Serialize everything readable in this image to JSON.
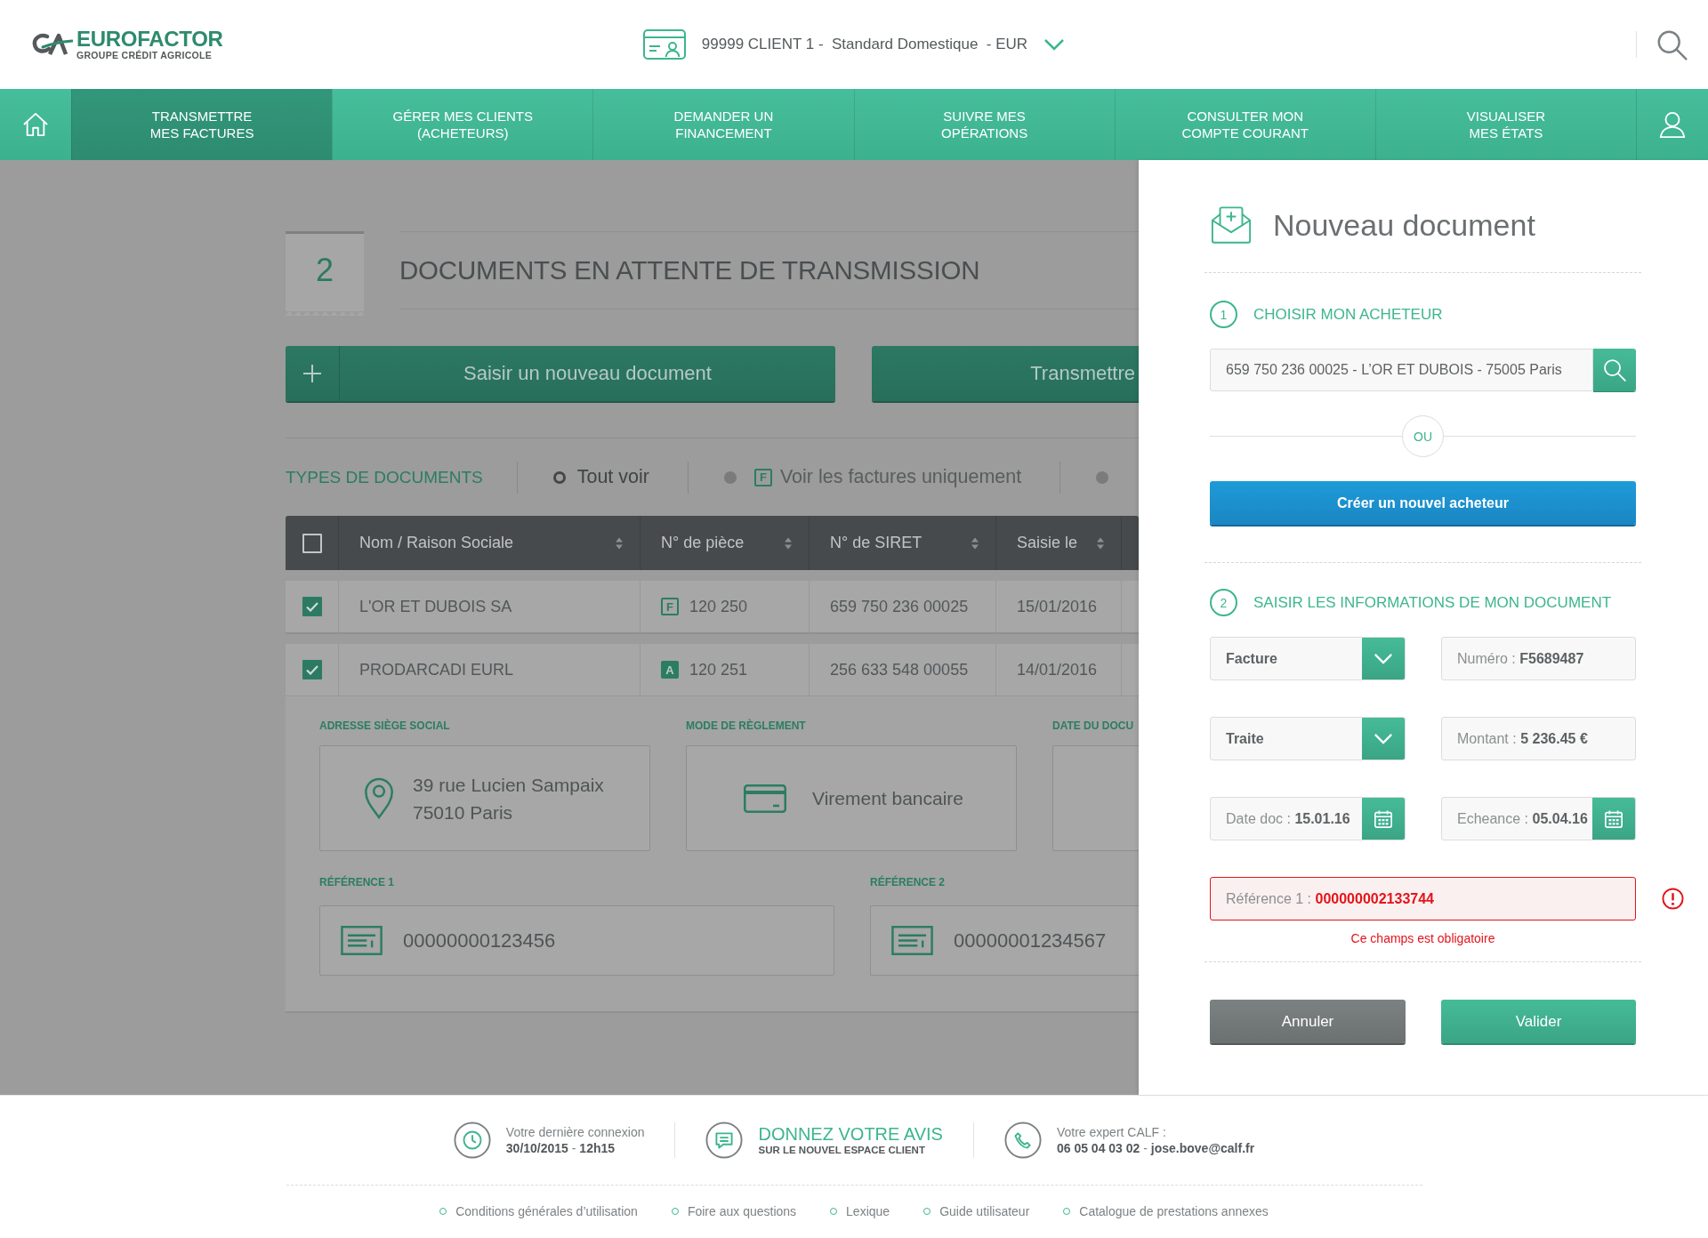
{
  "header": {
    "logo": {
      "brand": "EUROFACTOR",
      "tagline": "GROUPE CRÉDIT AGRICOLE"
    },
    "client_selector": {
      "label": "99999 CLIENT 1 -  Standard Domestique  - EUR"
    }
  },
  "nav": {
    "items": [
      {
        "label": "TRANSMETTRE\nMES FACTURES",
        "selected": true
      },
      {
        "label": "GÉRER MES CLIENTS\n(ACHETEURS)",
        "selected": false
      },
      {
        "label": "DEMANDER UN\nFINANCEMENT",
        "selected": false
      },
      {
        "label": "SUIVRE MES\nOPÉRATIONS",
        "selected": false
      },
      {
        "label": "CONSULTER MON\nCOMPTE COURANT",
        "selected": false
      },
      {
        "label": "VISUALISER\nMES ÉTATS",
        "selected": false
      }
    ]
  },
  "page_header": {
    "count": "2",
    "title": "DOCUMENTS EN ATTENTE DE TRANSMISSION"
  },
  "actions": [
    {
      "kind": "add",
      "label": "Saisir un nouveau document"
    },
    {
      "kind": "plain",
      "label": "Transmettre"
    }
  ],
  "document_types": {
    "label": "TYPES DE DOCUMENTS",
    "options": [
      {
        "label": "Tout voir",
        "selected": true
      },
      {
        "badge": "F",
        "label": "Voir les factures uniquement",
        "selected": false
      },
      {
        "selected": false
      }
    ]
  },
  "table": {
    "all_checked": false,
    "columns": [
      {
        "label": "Nom / Raison Sociale",
        "sortable": true
      },
      {
        "label": "N° de pièce",
        "sortable": true
      },
      {
        "label": "N° de SIRET",
        "sortable": true
      },
      {
        "label": "Saisie le",
        "sortable": true
      }
    ],
    "rows": [
      {
        "checked": true,
        "name": "L'OR ET DUBOIS SA",
        "doc_type": {
          "kind": "invoice",
          "code": "F"
        },
        "piece": "120 250",
        "siret": "659 750 236 00025",
        "date": "15/01/2016",
        "expanded": false
      },
      {
        "checked": true,
        "name": "PRODARCADI EURL",
        "doc_type": {
          "kind": "credit",
          "code": "A"
        },
        "piece": "120 251",
        "siret": "256 633 548 00055",
        "date": "14/01/2016",
        "expanded": true,
        "details": {
          "fields": [
            {
              "kind": "address",
              "label": "ADRESSE SIÈGE SOCIAL",
              "value": "39 rue Lucien Sampaix\n75010 Paris"
            },
            {
              "kind": "payment",
              "label": "MODE DE RÈGLEMENT",
              "value": "Virement bancaire"
            },
            {
              "kind": "blank",
              "label": "DATE DU DOCU"
            }
          ],
          "references": [
            {
              "label": "RÉFÉRENCE 1",
              "value": "00000000123456"
            },
            {
              "label": "RÉFÉRENCE 2",
              "value": "00000001234567"
            }
          ]
        }
      }
    ]
  },
  "new_document": {
    "title": "Nouveau document",
    "buyer_step": {
      "number": "1",
      "title": "CHOISIR MON ACHETEUR",
      "search": {
        "value": "659 750 236 00025 - L’OR ET DUBOIS - 75005 Paris"
      },
      "separator": "OU",
      "create_button": "Créer un nouvel acheteur"
    },
    "document_step": {
      "number": "2",
      "title": "SAISIR LES INFORMATIONS DE MON DOCUMENT",
      "fields": [
        {
          "kind": "select",
          "text": "Facture"
        },
        {
          "kind": "text",
          "text": "Numéro : **F5689487**"
        },
        {
          "kind": "select",
          "text": "Traite"
        },
        {
          "kind": "text",
          "text": "Montant : **5 236.45 €**"
        },
        {
          "kind": "date",
          "text": "Date doc : **15.01.16**"
        },
        {
          "kind": "date",
          "text": "Echeance : **05.04.16**"
        }
      ],
      "reference": {
        "kind": "text",
        "text": "Référence 1 : **000000002133744**",
        "invalid": true,
        "error": "Ce champs est obligatoire"
      }
    },
    "buttons": [
      {
        "kind": "secondary",
        "label": "Annuler"
      },
      {
        "kind": "primary",
        "label": "Valider"
      }
    ]
  },
  "footer": {
    "info": [
      {
        "kind": "last-login",
        "title": "Votre dernière connexion",
        "detail": "**30/10/2015** - **12h15**"
      },
      {
        "kind": "feedback",
        "title": "DONNEZ VOTRE AVIS",
        "detail": "SUR LE NOUVEL ESPACE CLIENT"
      },
      {
        "kind": "expert",
        "title": "Votre expert CALF :",
        "detail": "**06 05 04 03 02** - **jose.bove@calf.fr**"
      }
    ],
    "links": [
      "Conditions générales d’utilisation",
      "Foire aux questions",
      "Lexique",
      "Guide utilisateur",
      "Catalogue de prestations annexes"
    ]
  }
}
